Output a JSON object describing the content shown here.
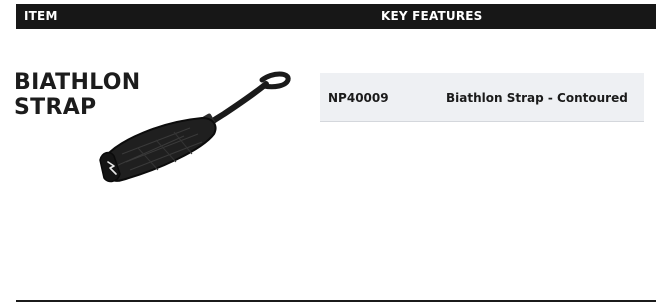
{
  "header": {
    "item_label": "ITEM",
    "features_label": "KEY FEATURES"
  },
  "product": {
    "title_line1": "BIATHLON",
    "title_line2": "STRAP",
    "image_icon": "biathlon-strap-photo"
  },
  "products": [
    {
      "code": "NP40009",
      "description": "Biathlon Strap - Contoured"
    }
  ],
  "colors": {
    "header_bg": "#171717",
    "header_text": "#ffffff",
    "row_bg": "#eef0f3",
    "text": "#1b1b1b"
  }
}
